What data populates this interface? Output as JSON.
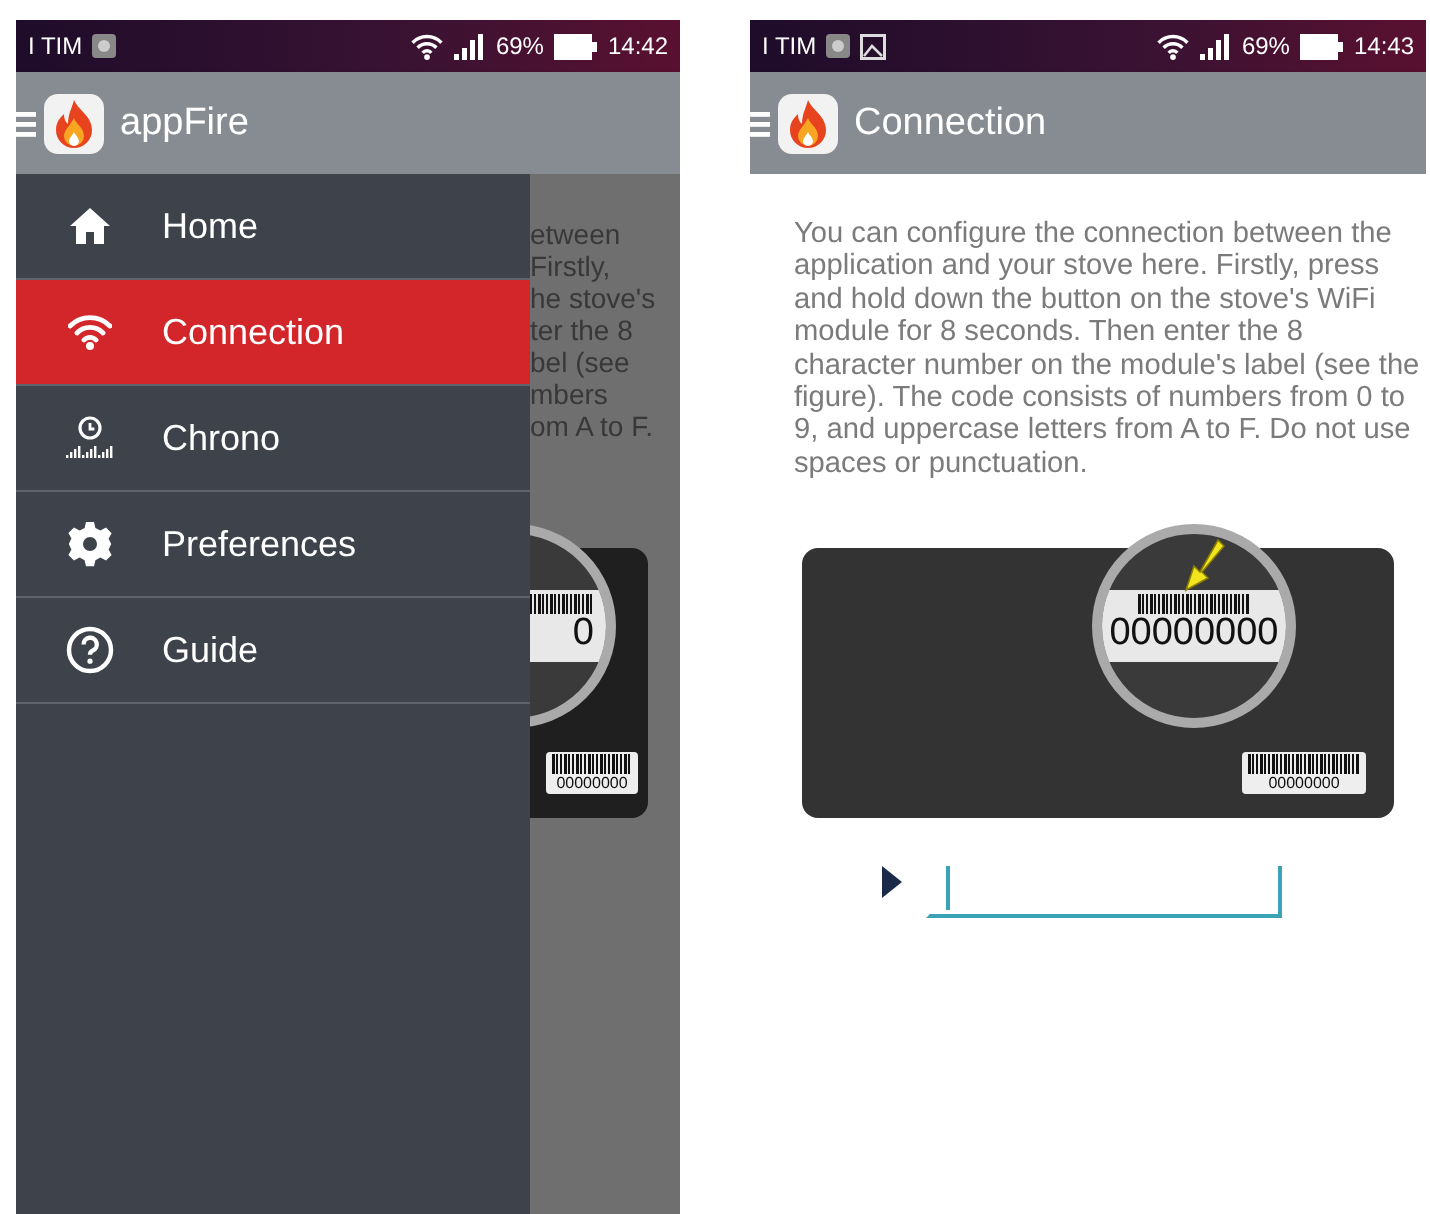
{
  "screens": [
    {
      "kind": "drawer",
      "status_bar": {
        "carrier": "I TIM",
        "battery": "69%",
        "time": "14:42"
      },
      "app_bar": {
        "title": "appFire"
      },
      "drawer": {
        "items": [
          {
            "kind": "home",
            "label": "Home",
            "selected": false
          },
          {
            "kind": "wifi",
            "label": "Connection",
            "selected": true
          },
          {
            "kind": "chrono",
            "label": "Chrono",
            "selected": false
          },
          {
            "kind": "settings",
            "label": "Preferences",
            "selected": false
          },
          {
            "kind": "help",
            "label": "Guide",
            "selected": false
          }
        ]
      },
      "background_fragments": [
        "etween",
        "Firstly,",
        "he stove's",
        "ter the 8",
        "bel (see",
        "mbers",
        "om A to F."
      ],
      "figure": {
        "main_code": "0",
        "label_code": "00000000"
      }
    },
    {
      "kind": "page",
      "status_bar": {
        "carrier": "I TIM",
        "battery": "69%",
        "time": "14:43"
      },
      "app_bar": {
        "title": "Connection"
      },
      "instructions": "You can configure the connection between the application and your stove here. Firstly, press and hold down the button on the stove's WiFi module for 8 seconds. Then enter the 8 character number on the module's label (see the figure). The code consists of numbers from 0 to 9, and uppercase letters from A to F. Do not use spaces or punctuation.",
      "figure": {
        "main_code": "00000000",
        "label_code": "00000000"
      }
    }
  ]
}
